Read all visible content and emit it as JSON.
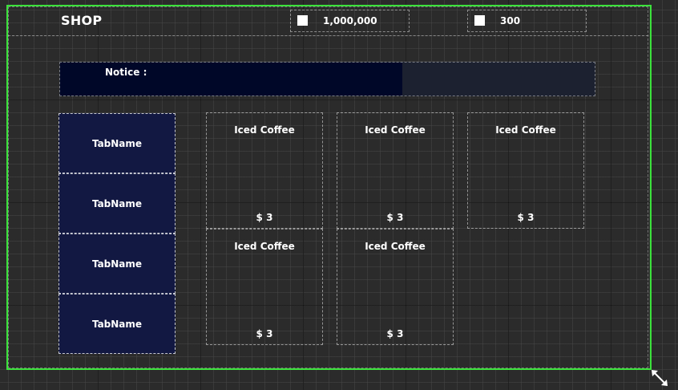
{
  "header": {
    "title": "SHOP"
  },
  "currencies": [
    {
      "value": "1,000,000"
    },
    {
      "value": "300"
    }
  ],
  "notice": {
    "label": "Notice :",
    "fill_fraction": 0.64
  },
  "tabs": [
    {
      "label": "TabName"
    },
    {
      "label": "TabName"
    },
    {
      "label": "TabName"
    },
    {
      "label": "TabName"
    }
  ],
  "items": [
    {
      "name": "Iced Coffee",
      "price": "$ 3"
    },
    {
      "name": "Iced Coffee",
      "price": "$ 3"
    },
    {
      "name": "Iced Coffee",
      "price": "$ 3"
    },
    {
      "name": "Iced Coffee",
      "price": "$ 3"
    },
    {
      "name": "Iced Coffee",
      "price": "$ 3"
    }
  ],
  "colors": {
    "canvas_border": "#3be23b",
    "tab_background": "#121842",
    "notice_fill": "#000728",
    "notice_track": "#1c2130"
  },
  "icons": {
    "currency_gold": "square-icon",
    "currency_gem": "square-icon",
    "resize": "resize-arrows-icon"
  }
}
